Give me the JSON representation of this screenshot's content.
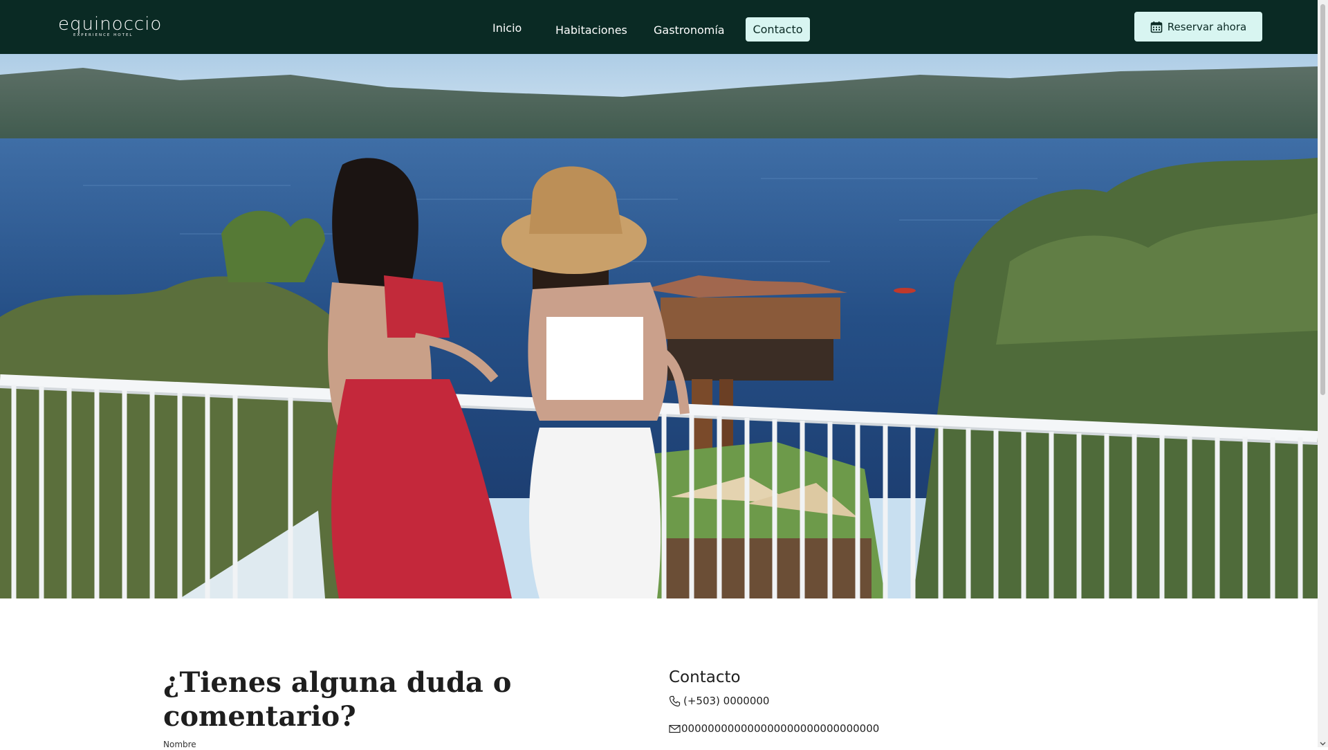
{
  "header": {
    "logo_text": "equinoccio",
    "logo_sub": "EXPERIENCE HOTEL",
    "nav": [
      {
        "label": "Inicio"
      },
      {
        "label": "Habitaciones"
      },
      {
        "label": "Gastronomía"
      },
      {
        "label": "Contacto",
        "active": true
      }
    ],
    "reserve_label": "Reservar ahora",
    "reserve_icon": "calendar-icon"
  },
  "hero": {
    "image_description_icon": "hero-photo"
  },
  "form": {
    "heading": "¿Tienes alguna duda o comentario?",
    "name_label": "Nombre"
  },
  "contact": {
    "heading": "Contacto",
    "phone": "(+503) 0000000",
    "phone_icon": "phone-icon",
    "email": "000000000000000000000000000000",
    "email_icon": "mail-icon"
  },
  "colors": {
    "topbar": "#0a2a24",
    "accent_button": "#d8f5f1",
    "text_dark": "#1e1e1e"
  }
}
